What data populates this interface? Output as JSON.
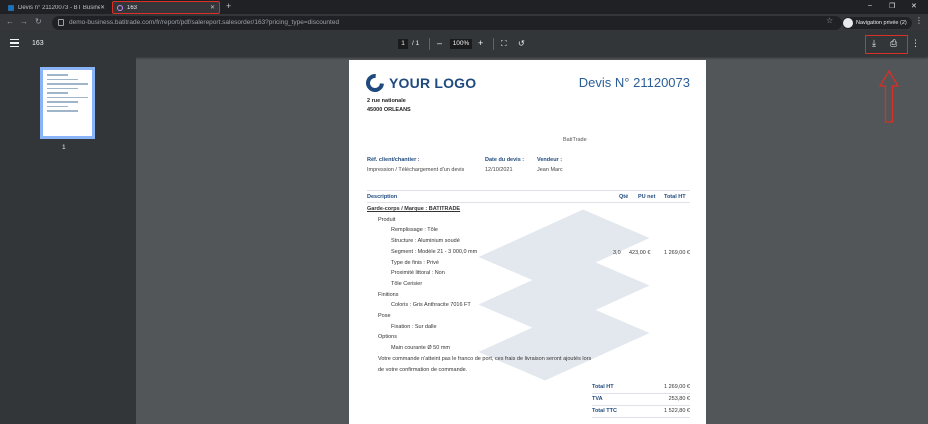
{
  "browser": {
    "tabs": [
      {
        "title": "Devis n° 21120073 - BT Business",
        "active": false
      },
      {
        "title": "163",
        "active": true
      }
    ],
    "new_tab": "+",
    "url": "demo-business.batitrade.com/fr/report/pdf/salereport.salesorder/163?pricing_type=discounted",
    "profile_name": "Navigation privée (2)",
    "window_controls": {
      "minimize": "–",
      "maximize": "❐",
      "close": "✕"
    }
  },
  "pdf_viewer": {
    "title": "163",
    "current_page": "1",
    "page_separator": "/ 1",
    "zoom": "100%",
    "zoom_out": "–",
    "zoom_in": "+",
    "thumbnail_label": "1"
  },
  "document": {
    "logo_text": "YOUR LOGO",
    "title": "Devis N° 21120073",
    "address_line1": "2 rue nationale",
    "address_line2": "45000 ORLEANS",
    "company": "BatiTrade",
    "ref_label": "Réf. client/chantier :",
    "ref_value": "Impression / Téléchargement d'un devis",
    "date_label": "Date du devis :",
    "date_value": "12/10/2021",
    "seller_label": "Vendeur :",
    "seller_value": "Jean Marc",
    "col_description": "Description",
    "col_qty": "Qté",
    "col_unit": "PU net",
    "col_total": "Total HT",
    "lines": [
      {
        "text": "Garde-corps / Marque : BATITRADE",
        "indent": 1,
        "underline": true
      },
      {
        "text": "Produit",
        "indent": 2
      },
      {
        "text": "Remplissage : Tôle",
        "indent": 3
      },
      {
        "text": "Structure : Aluminium soudé",
        "indent": 3
      },
      {
        "text": "Segment : Modèle 21 - 3 000,0 mm",
        "indent": 3
      },
      {
        "text": "Type de finis : Privé",
        "indent": 3
      },
      {
        "text": "Proximité littoral : Non",
        "indent": 3
      },
      {
        "text": "Tôle Cerisier",
        "indent": 3
      },
      {
        "text": "Finitions",
        "indent": 2
      },
      {
        "text": "Coloris : Gris Anthracite 7016 FT",
        "indent": 3
      },
      {
        "text": "Pose",
        "indent": 2
      },
      {
        "text": "Fixation : Sur dalle",
        "indent": 3
      },
      {
        "text": "Options",
        "indent": 2
      },
      {
        "text": "Main courante Ø 50 mm",
        "indent": 3
      },
      {
        "text": "Votre commande n'atteint pas le franco de port, ces frais de livraison seront ajoutés lors",
        "indent": 2
      },
      {
        "text": "de votre confirmation de commande.",
        "indent": 2
      }
    ],
    "row_values": {
      "qty": "3,0",
      "unit": "423,00 €",
      "total": "1 269,00 €"
    },
    "totals": [
      {
        "label": "Total HT",
        "value": "1 269,00 €"
      },
      {
        "label": "TVA",
        "value": "253,80 €"
      },
      {
        "label": "Total TTC",
        "value": "1 522,80 €"
      }
    ]
  },
  "colors": {
    "annotation": "#d93025",
    "brand": "#1f4a7e",
    "viewer_bg": "#525659"
  }
}
